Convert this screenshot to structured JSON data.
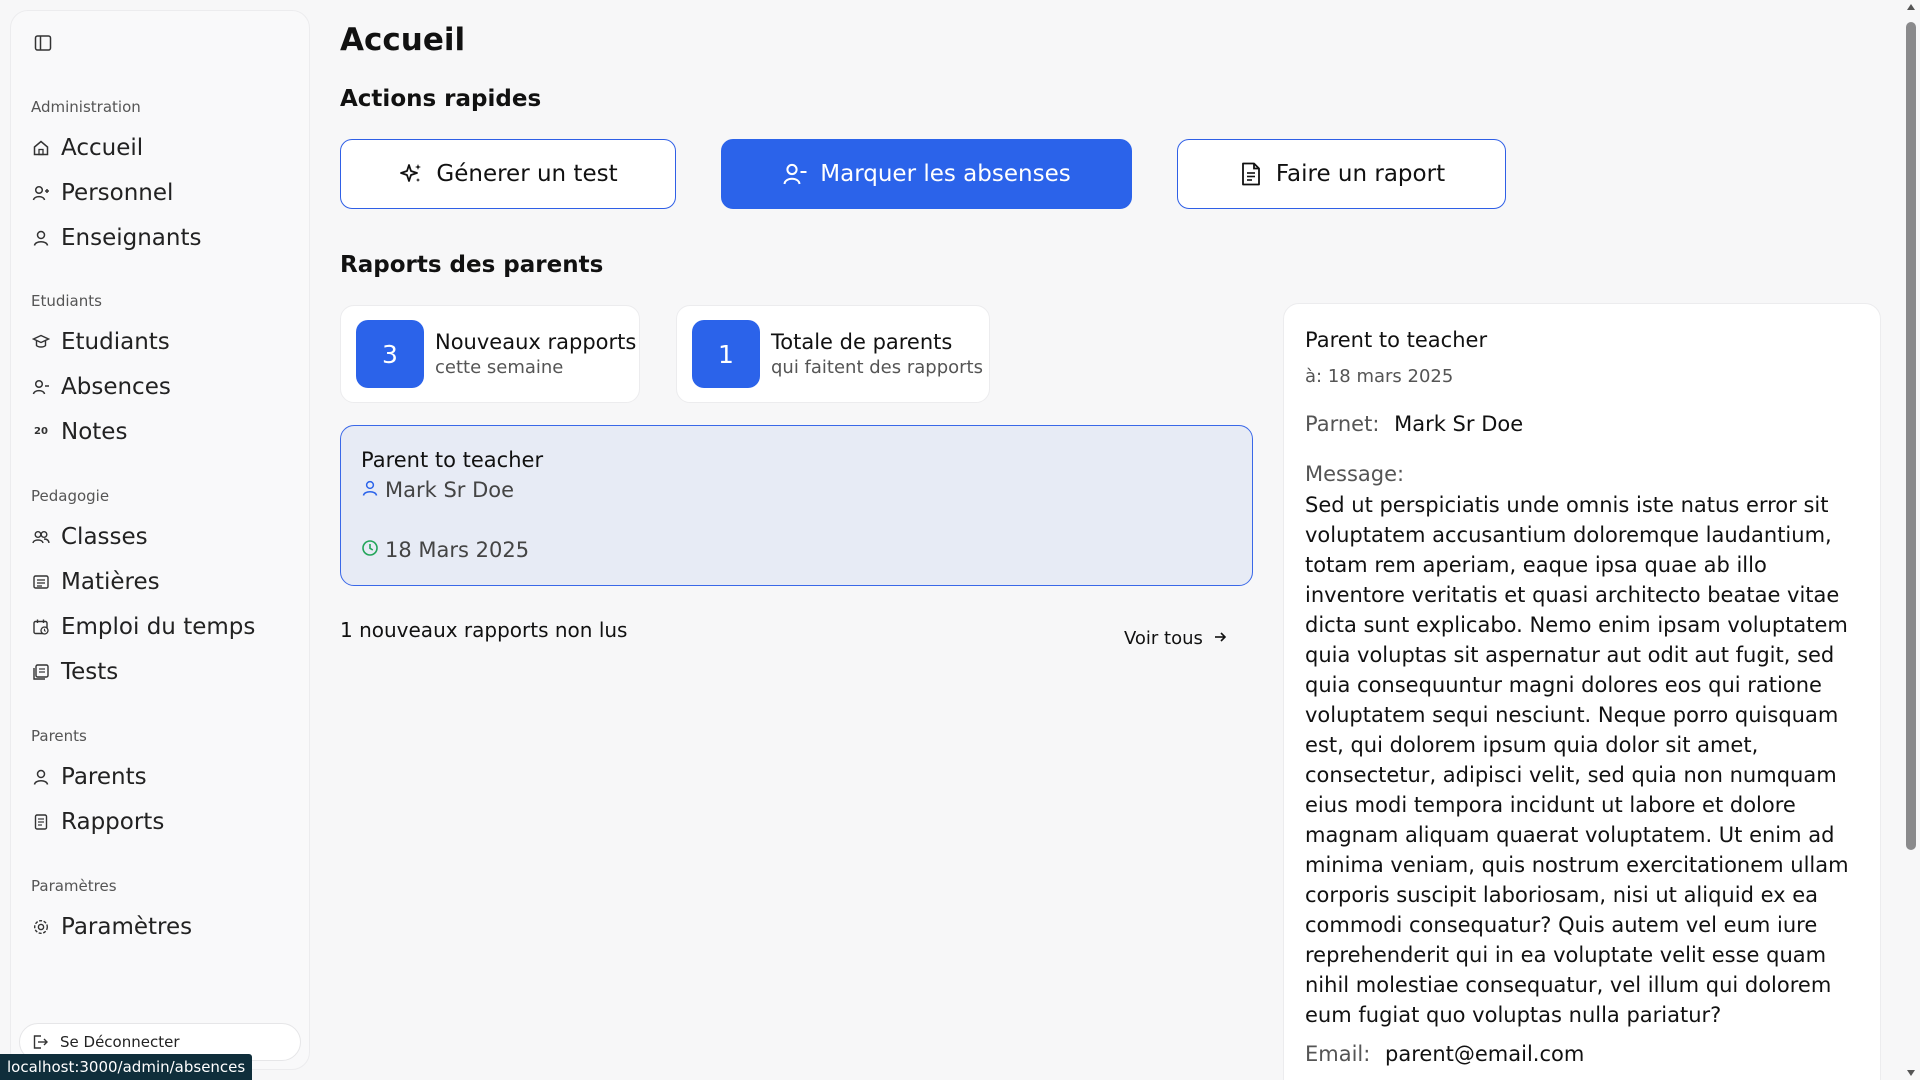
{
  "sidebar": {
    "groups": [
      {
        "title": "Administration",
        "items": [
          {
            "label": "Accueil",
            "icon": "home-icon"
          },
          {
            "label": "Personnel",
            "icon": "user-plus-icon"
          },
          {
            "label": "Enseignants",
            "icon": "user-icon"
          }
        ]
      },
      {
        "title": "Etudiants",
        "items": [
          {
            "label": "Etudiants",
            "icon": "graduation-cap-icon"
          },
          {
            "label": "Absences",
            "icon": "user-minus-icon"
          },
          {
            "label": "Notes",
            "icon": "grade-20-icon"
          }
        ]
      },
      {
        "title": "Pedagogie",
        "items": [
          {
            "label": "Classes",
            "icon": "users-icon"
          },
          {
            "label": "Matières",
            "icon": "list-icon"
          },
          {
            "label": "Emploi du temps",
            "icon": "calendar-clock-icon"
          },
          {
            "label": "Tests",
            "icon": "book-icon"
          }
        ]
      },
      {
        "title": "Parents",
        "items": [
          {
            "label": "Parents",
            "icon": "user-icon"
          },
          {
            "label": "Rapports",
            "icon": "document-icon"
          }
        ]
      },
      {
        "title": "Paramètres",
        "items": [
          {
            "label": "Paramètres",
            "icon": "gear-icon"
          }
        ]
      }
    ],
    "logout_label": "Se Déconnecter"
  },
  "main": {
    "title": "Accueil",
    "quick_actions_title": "Actions rapides",
    "actions": [
      {
        "label": "Génerer un test",
        "icon": "sparkles-icon"
      },
      {
        "label": "Marquer les absenses",
        "icon": "user-minus-icon"
      },
      {
        "label": "Faire un raport",
        "icon": "document-icon"
      }
    ],
    "reports_title": "Raports des parents",
    "stats": [
      {
        "value": "3",
        "line1": "Nouveaux rapports",
        "line2": "cette semaine"
      },
      {
        "value": "1",
        "line1": "Totale de parents",
        "line2": "qui faitent des rapports"
      }
    ],
    "report_card": {
      "title": "Parent to teacher",
      "parent": "Mark Sr Doe",
      "date": "18 Mars 2025"
    },
    "unread_text": "1 nouveaux rapports non lus",
    "see_all": "Voir tous"
  },
  "detail": {
    "title": "Parent to teacher",
    "date": "à: 18 mars 2025",
    "parent_label": "Parnet:",
    "parent_value": "Mark Sr Doe",
    "message_label": "Message:",
    "message": "Sed ut perspiciatis unde omnis iste natus error sit voluptatem accusantium doloremque laudantium, totam rem aperiam, eaque ipsa quae ab illo inventore veritatis et quasi architecto beatae vitae dicta sunt explicabo. Nemo enim ipsam voluptatem quia voluptas sit aspernatur aut odit aut fugit, sed quia consequuntur magni dolores eos qui ratione voluptatem sequi nesciunt. Neque porro quisquam est, qui dolorem ipsum quia dolor sit amet, consectetur, adipisci velit, sed quia non numquam eius modi tempora incidunt ut labore et dolore magnam aliquam quaerat voluptatem. Ut enim ad minima veniam, quis nostrum exercitationem ullam corporis suscipit laboriosam, nisi ut aliquid ex ea commodi consequatur? Quis autem vel eum iure reprehenderit qui in ea voluptate velit esse quam nihil molestiae consequatur, vel illum qui dolorem eum fugiat quo voluptas nulla pariatur?",
    "email_label": "Email:",
    "email_value": "parent@email.com"
  },
  "status_url": "localhost:3000/admin/absences",
  "colors": {
    "accent": "#2b63ea",
    "card_selected_bg": "#e7ebf5",
    "green": "#22a559"
  }
}
